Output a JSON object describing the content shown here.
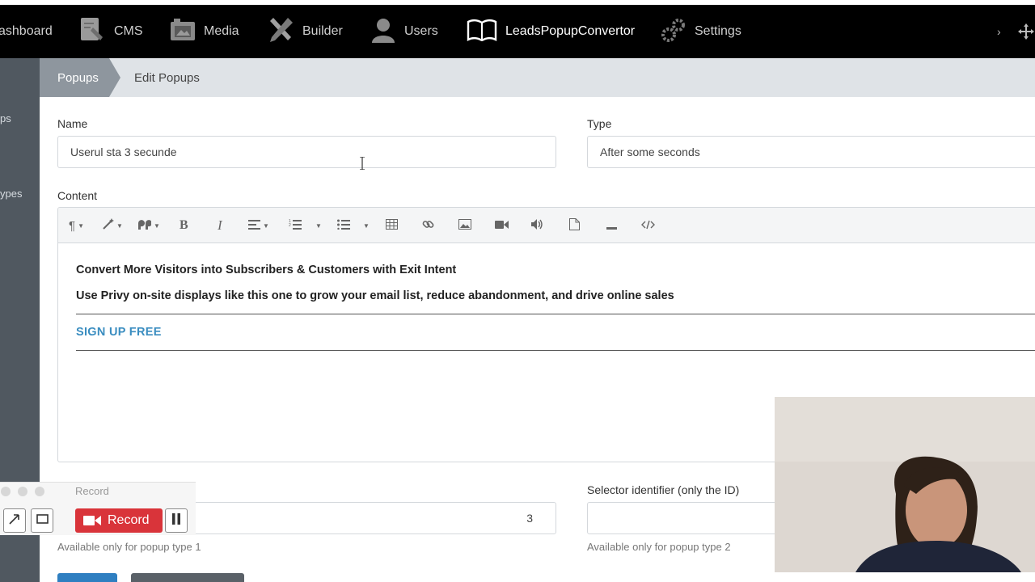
{
  "nav": {
    "items": [
      {
        "label": "ashboard",
        "icon": "dashboard-icon"
      },
      {
        "label": "CMS",
        "icon": "cms-icon"
      },
      {
        "label": "Media",
        "icon": "media-icon"
      },
      {
        "label": "Builder",
        "icon": "builder-icon"
      },
      {
        "label": "Users",
        "icon": "users-icon"
      },
      {
        "label": "LeadsPopupConvertor",
        "icon": "book-icon"
      },
      {
        "label": "Settings",
        "icon": "gear-icon"
      }
    ],
    "chevron": "›"
  },
  "sidebar": {
    "items": [
      {
        "label": "ps"
      },
      {
        "label": "ypes"
      }
    ]
  },
  "breadcrumb": {
    "first": "Popups",
    "second": "Edit Popups"
  },
  "form": {
    "name_label": "Name",
    "name_value": "Userul sta 3 secunde",
    "type_label": "Type",
    "type_value": "After some seconds",
    "content_label": "Content",
    "content": {
      "line1": "Convert More Visitors into Subscribers & Customers with Exit Intent",
      "line2": "Use Privy on-site displays like this one to grow your email list, reduce abandonment, and drive online sales",
      "cta": "SIGN UP FREE"
    },
    "seconds_value": "3",
    "seconds_hint": "Available only for popup type 1",
    "selector_label": "Selector identifier (only the ID)",
    "selector_value": "",
    "selector_hint": "Available only for popup type 2"
  },
  "toolbar": {
    "paragraph": "¶",
    "bold": "B",
    "italic": "I"
  },
  "recorder": {
    "title": "Record",
    "button_label": "Record",
    "accent": "#d9343a"
  },
  "colors": {
    "topbar": "#000000",
    "sidebar": "#505860",
    "breadcrumb_active": "#8e969e",
    "link": "#3a8dc0"
  }
}
